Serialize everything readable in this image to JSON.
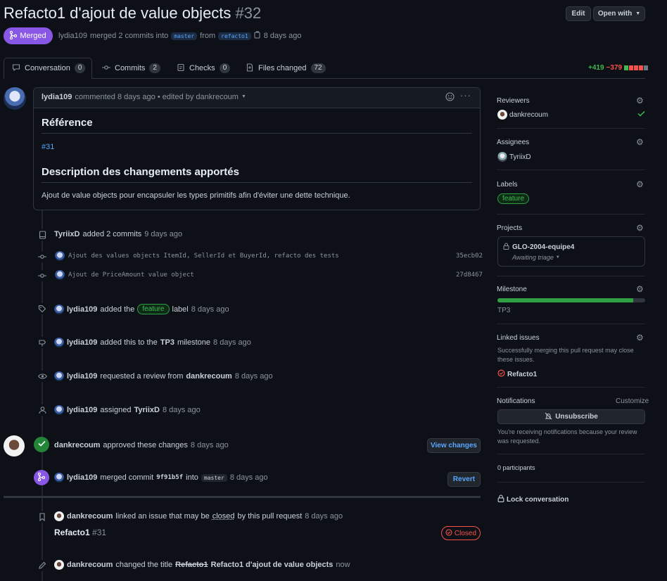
{
  "header": {
    "title": "Refacto1 d'ajout de value objects",
    "number": "#32",
    "edit_label": "Edit",
    "open_with_label": "Open with",
    "state_label": "Merged",
    "meta_author": "lydia109",
    "meta_merged_text": "merged 2 commits into",
    "base_branch": "master",
    "from_text": "from",
    "head_branch": "refacto1",
    "meta_time": "8 days ago"
  },
  "tabs": [
    {
      "label": "Conversation",
      "count": "0"
    },
    {
      "label": "Commits",
      "count": "2"
    },
    {
      "label": "Checks",
      "count": "0"
    },
    {
      "label": "Files changed",
      "count": "72"
    }
  ],
  "diffstat": {
    "additions": "+419",
    "deletions": "−379"
  },
  "comment": {
    "author": "lydia109",
    "meta": "commented 8 days ago • edited by dankrecoum",
    "h1": "Référence",
    "ref_link": "#31",
    "h2": "Description des changements apportés",
    "body": "Ajout de value objects pour encapsuler les types primitifs afin d'éviter une dette technique."
  },
  "events": {
    "commits_added": {
      "actor": "TyriixD",
      "text": "added 2 commits",
      "time": "9 days ago"
    },
    "commit1": {
      "message": "Ajout des values objects ItemId, SellerId et BuyerId, refacto des tests",
      "sha": "35ecb02"
    },
    "commit2": {
      "message": "Ajout de PriceAmount value object",
      "sha": "27d8467"
    },
    "label_added": {
      "actor": "lydia109",
      "text1": "added the",
      "label": "feature",
      "text2": "label",
      "time": "8 days ago"
    },
    "milestone": {
      "actor": "lydia109",
      "text1": "added this to the",
      "milestone": "TP3",
      "text2": "milestone",
      "time": "8 days ago"
    },
    "review_req": {
      "actor": "lydia109",
      "text": "requested a review from",
      "target": "dankrecoum",
      "time": "8 days ago"
    },
    "assigned": {
      "actor": "lydia109",
      "text": "assigned",
      "target": "TyriixD",
      "time": "8 days ago"
    },
    "approved": {
      "actor": "dankrecoum",
      "text": "approved these changes",
      "time": "8 days ago",
      "button": "View changes"
    },
    "merged": {
      "actor": "lydia109",
      "text1": "merged commit",
      "sha": "9f91b5f",
      "text2": "into",
      "branch": "master",
      "time": "8 days ago",
      "button": "Revert"
    },
    "linked": {
      "actor": "dankrecoum",
      "text1": "linked an issue that may be",
      "closed_word": "closed",
      "text2": "by this pull request",
      "time": "8 days ago",
      "issue_title": "Refacto1",
      "issue_number": "#31",
      "issue_state": "Closed"
    },
    "renamed": {
      "actor": "dankrecoum",
      "text": "changed the title",
      "old_title": "Refacto1",
      "new_title": "Refacto1 d'ajout de value objects",
      "time": "now"
    }
  },
  "sidebar": {
    "reviewers_h": "Reviewers",
    "reviewer": "dankrecoum",
    "assignees_h": "Assignees",
    "assignee": "TyriixD",
    "labels_h": "Labels",
    "label": "feature",
    "projects_h": "Projects",
    "project_name": "GLO-2004-equipe4",
    "project_status": "Awaiting triage",
    "milestone_h": "Milestone",
    "milestone_name": "TP3",
    "milestone_progress": 0.92,
    "linked_h": "Linked issues",
    "linked_desc": "Successfully merging this pull request may close these issues.",
    "linked_issue": "Refacto1",
    "notifications_h": "Notifications",
    "customize": "Customize",
    "unsubscribe": "Unsubscribe",
    "notif_desc": "You're receiving notifications because your review was requested.",
    "participants": "0 participants",
    "lock": "Lock conversation"
  },
  "colors": {
    "merged": "#8957e5",
    "approved": "#238636",
    "closed": "#f85149",
    "additions": "#3fb950",
    "deletions": "#f85149",
    "link": "#58a6ff"
  }
}
